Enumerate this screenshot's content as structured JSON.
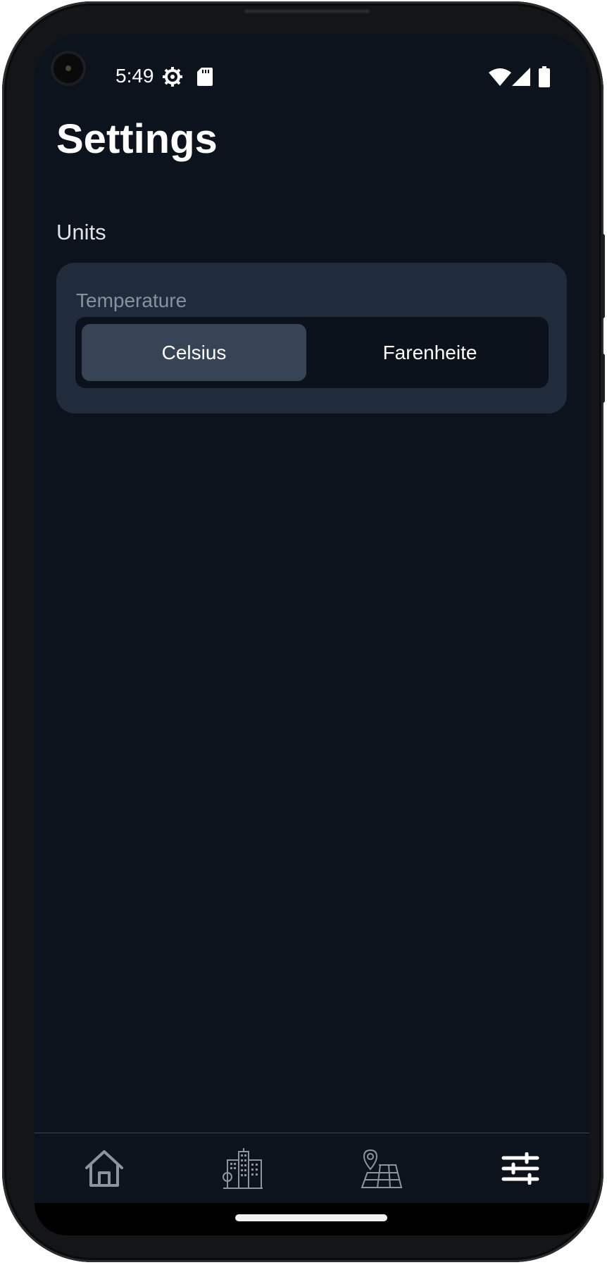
{
  "status_bar": {
    "time": "5:49",
    "icons": [
      "settings-gear-icon",
      "sd-card-icon",
      "wifi-icon",
      "cell-signal-icon",
      "battery-icon"
    ]
  },
  "page": {
    "title": "Settings"
  },
  "units_section": {
    "label": "Units",
    "temperature": {
      "label": "Temperature",
      "options": [
        "Celsius",
        "Farenheite"
      ],
      "selected": "Celsius"
    }
  },
  "bottom_nav": {
    "items": [
      {
        "icon": "home-icon",
        "active": false
      },
      {
        "icon": "city-buildings-icon",
        "active": false
      },
      {
        "icon": "map-pin-icon",
        "active": false
      },
      {
        "icon": "sliders-icon",
        "active": true
      }
    ]
  },
  "colors": {
    "background": "#0d131c",
    "card": "#202c3c",
    "selected_segment": "#374455",
    "text_primary": "#ffffff",
    "text_muted": "#8791a0",
    "nav_inactive": "#8e949c"
  }
}
